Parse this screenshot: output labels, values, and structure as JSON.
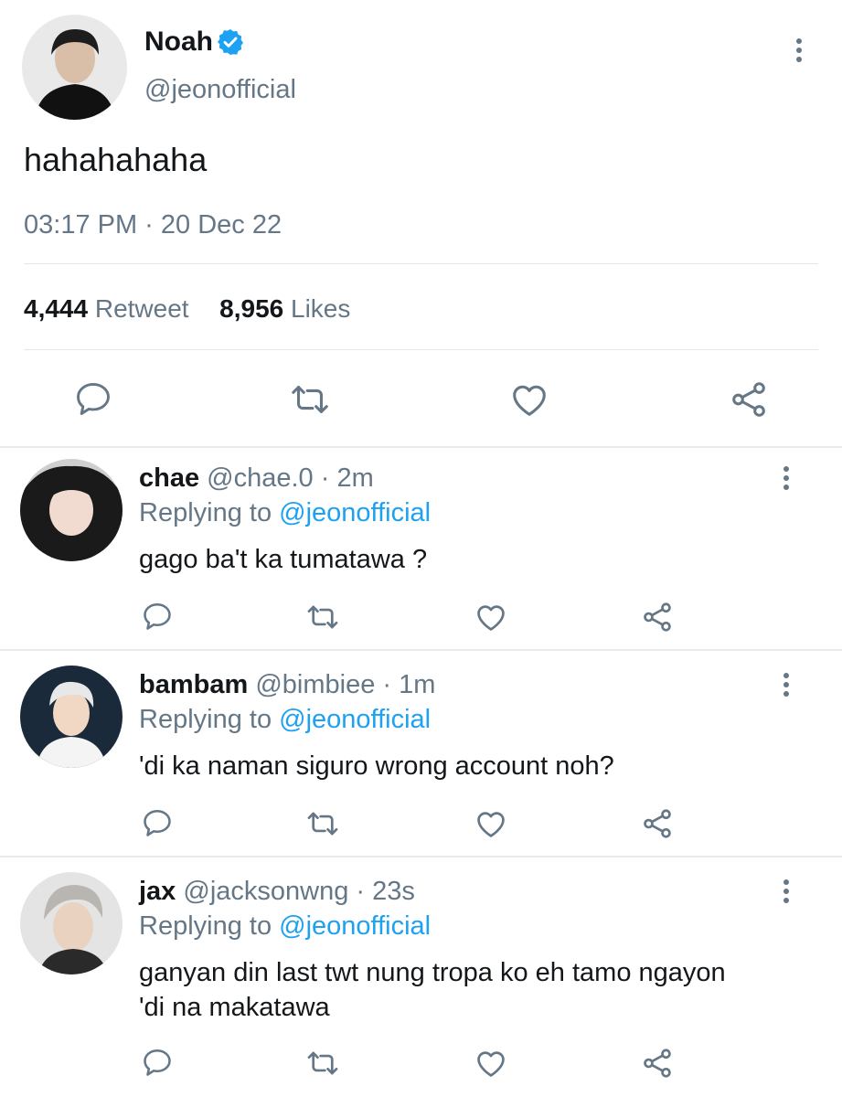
{
  "tweet": {
    "name": "Noah",
    "handle": "@jeonofficial",
    "text": "hahahahaha",
    "timestamp": "03:17 PM · 20 Dec 22",
    "retweet_count": "4,444",
    "retweet_label": "Retweet",
    "like_count": "8,956",
    "like_label": "Likes"
  },
  "replies": [
    {
      "name": "chae",
      "handle": "@chae.0",
      "time": "· 2m",
      "replying_label": "Replying to",
      "replying_to": "@jeonofficial",
      "text": "gago ba't ka tumatawa ?"
    },
    {
      "name": "bambam",
      "handle": "@bimbiee",
      "time": "· 1m",
      "replying_label": "Replying to",
      "replying_to": "@jeonofficial",
      "text": "'di ka naman siguro wrong account noh?"
    },
    {
      "name": "jax",
      "handle": "@jacksonwng",
      "time": "· 23s",
      "replying_label": "Replying to",
      "replying_to": "@jeonofficial",
      "text_line1": "ganyan din last twt nung tropa ko eh tamo ngayon",
      "text_line2": "'di na makatawa"
    }
  ],
  "colors": {
    "accent": "#1da1f2",
    "secondary_text": "#657786",
    "divider": "#e1e8ed"
  },
  "icons": [
    "verified-badge-icon",
    "more-options-icon",
    "reply-icon",
    "retweet-icon",
    "like-icon",
    "share-icon"
  ]
}
